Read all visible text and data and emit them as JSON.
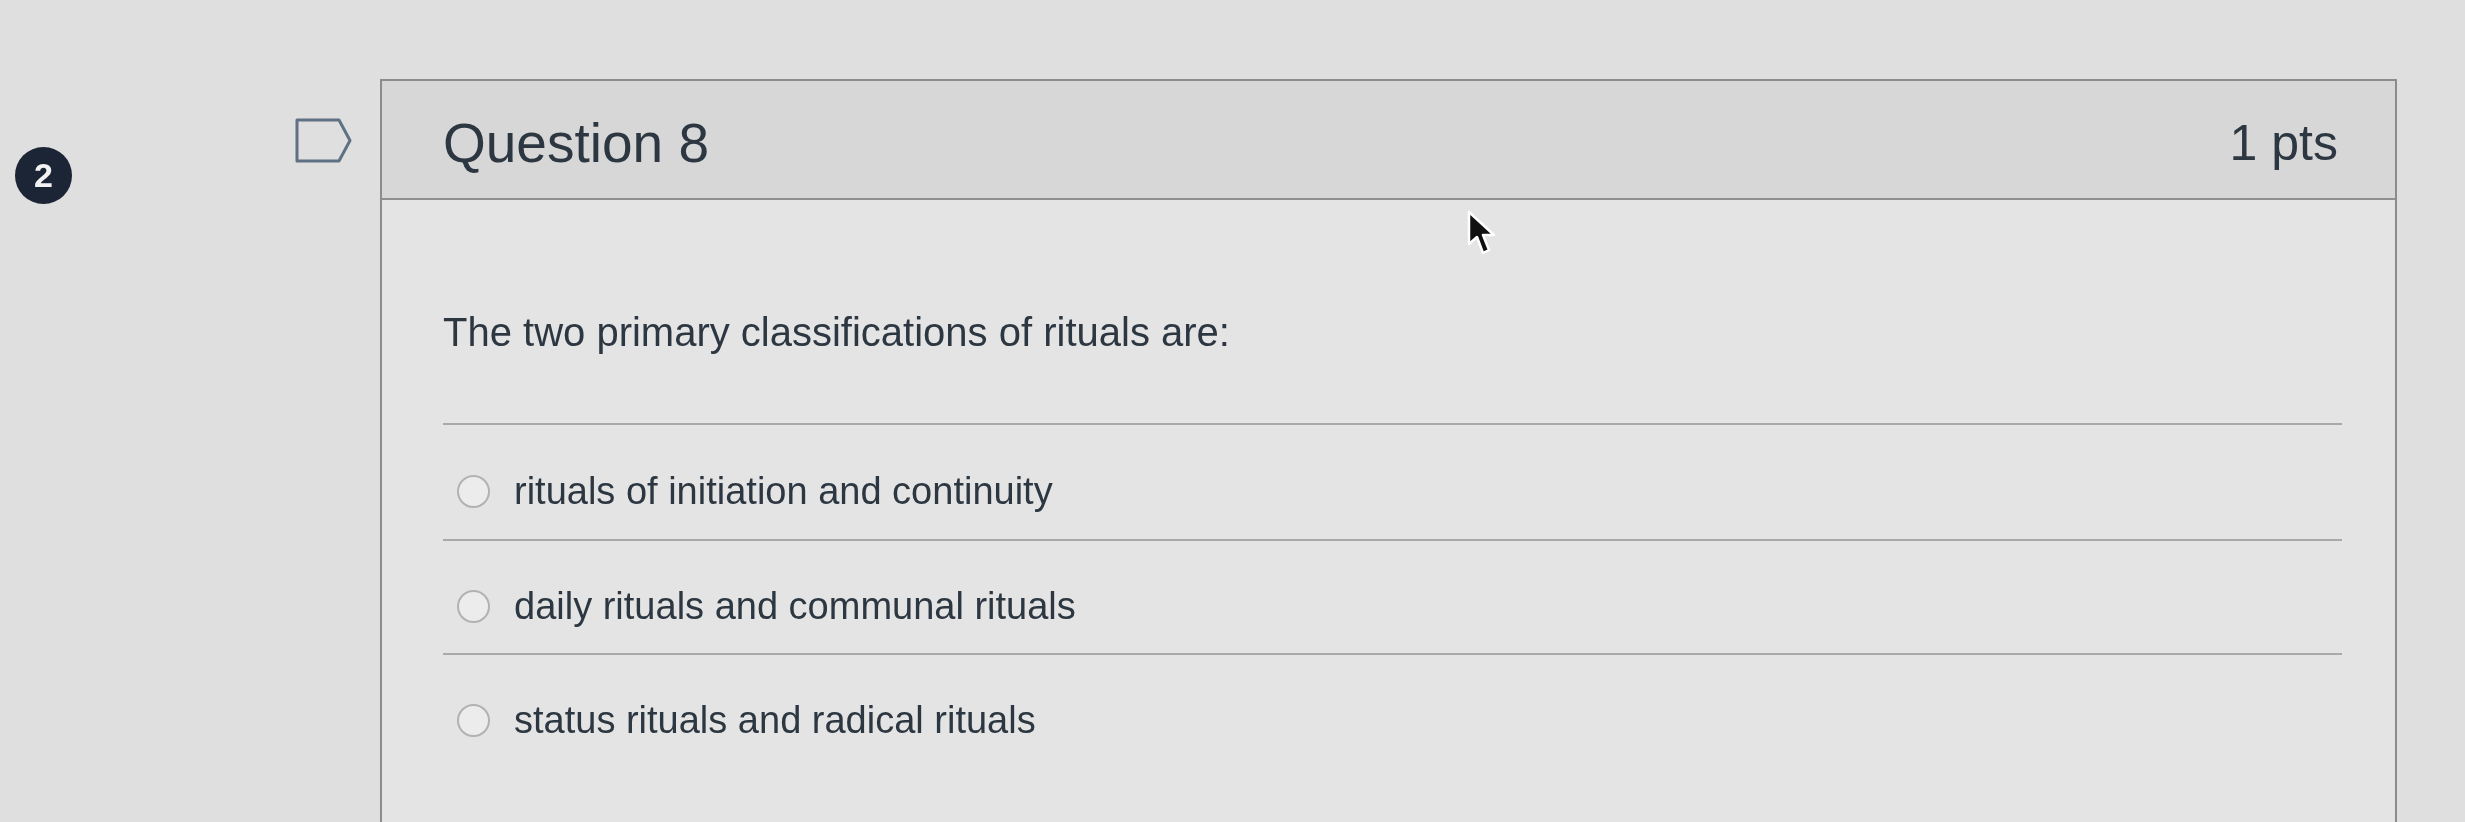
{
  "badge": "2",
  "question": {
    "title": "Question 8",
    "points": "1 pts",
    "flagged": false,
    "text": "The two primary classifications of rituals are:",
    "answers": [
      {
        "label": "rituals of initiation and continuity",
        "selected": false
      },
      {
        "label": "daily rituals and communal rituals",
        "selected": false
      },
      {
        "label": "status rituals and radical rituals",
        "selected": false
      }
    ]
  }
}
